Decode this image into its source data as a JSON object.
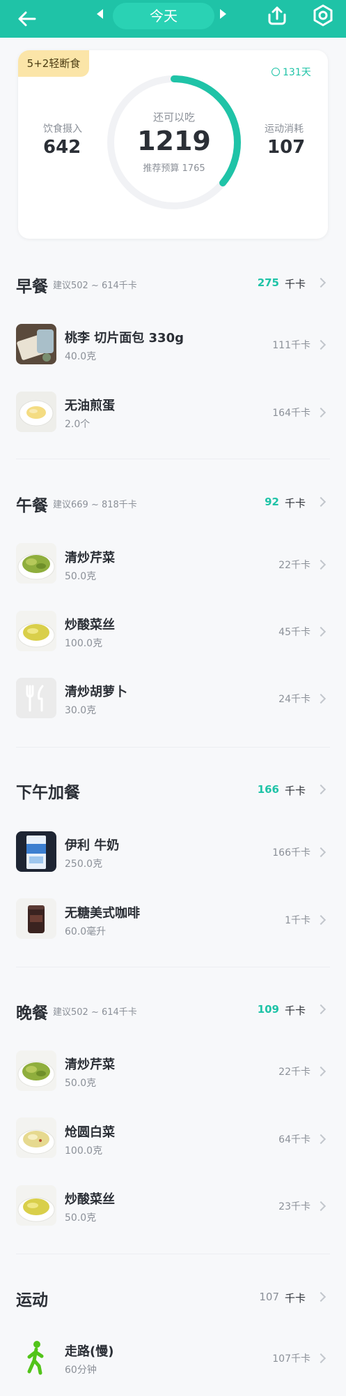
{
  "header": {
    "date_label": "今天"
  },
  "summary": {
    "plan_tag": "5+2轻断食",
    "streak": "131天",
    "intake_label": "饮食摄入",
    "intake_value": "642",
    "remaining_label": "还可以吃",
    "remaining_value": "1219",
    "budget_label": "推荐预算 1765",
    "exercise_label": "运动消耗",
    "exercise_value": "107",
    "progress_fraction": 0.36
  },
  "unit_kcal": "千卡",
  "colors": {
    "accent": "#1fc3a7",
    "header_bg": "#1fc3a7",
    "tag_bg": "#fbe5a8"
  },
  "sections": {
    "breakfast": {
      "title": "早餐",
      "hint": "建议502 ~ 614千卡",
      "kcal": "275",
      "items": [
        {
          "name": "桃李 切片面包 330g",
          "amount": "40.0克",
          "kcal": "111千卡"
        },
        {
          "name": "无油煎蛋",
          "amount": "2.0个",
          "kcal": "164千卡"
        }
      ]
    },
    "lunch": {
      "title": "午餐",
      "hint": "建议669 ~ 818千卡",
      "kcal": "92",
      "items": [
        {
          "name": "清炒芹菜",
          "amount": "50.0克",
          "kcal": "22千卡"
        },
        {
          "name": "炒酸菜丝",
          "amount": "100.0克",
          "kcal": "45千卡"
        },
        {
          "name": "清炒胡萝卜",
          "amount": "30.0克",
          "kcal": "24千卡"
        }
      ]
    },
    "snack": {
      "title": "下午加餐",
      "kcal": "166",
      "items": [
        {
          "name": "伊利 牛奶",
          "amount": "250.0克",
          "kcal": "166千卡"
        },
        {
          "name": "无糖美式咖啡",
          "amount": "60.0毫升",
          "kcal": "1千卡"
        }
      ]
    },
    "dinner": {
      "title": "晚餐",
      "hint": "建议502 ~ 614千卡",
      "kcal": "109",
      "items": [
        {
          "name": "清炒芹菜",
          "amount": "50.0克",
          "kcal": "22千卡"
        },
        {
          "name": "炝圆白菜",
          "amount": "100.0克",
          "kcal": "64千卡"
        },
        {
          "name": "炒酸菜丝",
          "amount": "50.0克",
          "kcal": "23千卡"
        }
      ]
    },
    "exercise": {
      "title": "运动",
      "kcal": "107",
      "items": [
        {
          "name": "走路(慢)",
          "amount": "60分钟",
          "kcal": "107千卡"
        }
      ]
    }
  }
}
